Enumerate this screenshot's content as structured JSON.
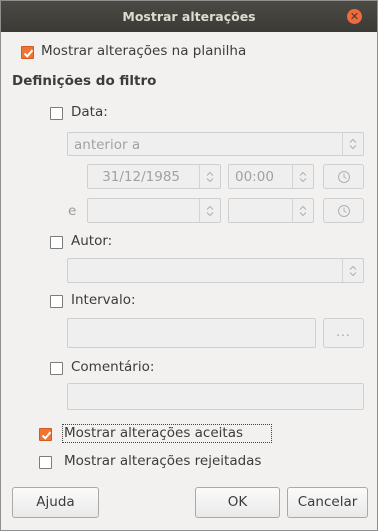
{
  "window": {
    "title": "Mostrar alterações"
  },
  "show_changes": {
    "label": "Mostrar alterações na planilha",
    "checked": true
  },
  "filter": {
    "heading": "Definições do filtro",
    "date": {
      "label": "Data:",
      "condition": "anterior a",
      "from_date": "31/12/1985",
      "from_time": "00:00",
      "and_label": "e",
      "to_date": "",
      "to_time": ""
    },
    "author": {
      "label": "Autor:",
      "value": ""
    },
    "range": {
      "label": "Intervalo:",
      "value": "",
      "button_label": "..."
    },
    "comment": {
      "label": "Comentário:",
      "value": ""
    }
  },
  "show_accepted": {
    "label": "Mostrar alterações aceitas",
    "checked": true
  },
  "show_rejected": {
    "label": "Mostrar alterações rejeitadas",
    "checked": false
  },
  "buttons": {
    "help": "Ajuda",
    "ok": "OK",
    "cancel": "Cancelar"
  },
  "colors": {
    "accent": "#ef7433",
    "titlebar": "#3c3b37",
    "close": "#ef6a3c"
  },
  "icons": {
    "close": "close-icon",
    "clock": "clock-icon",
    "spin": "spin-arrows-icon",
    "check": "check-icon"
  }
}
